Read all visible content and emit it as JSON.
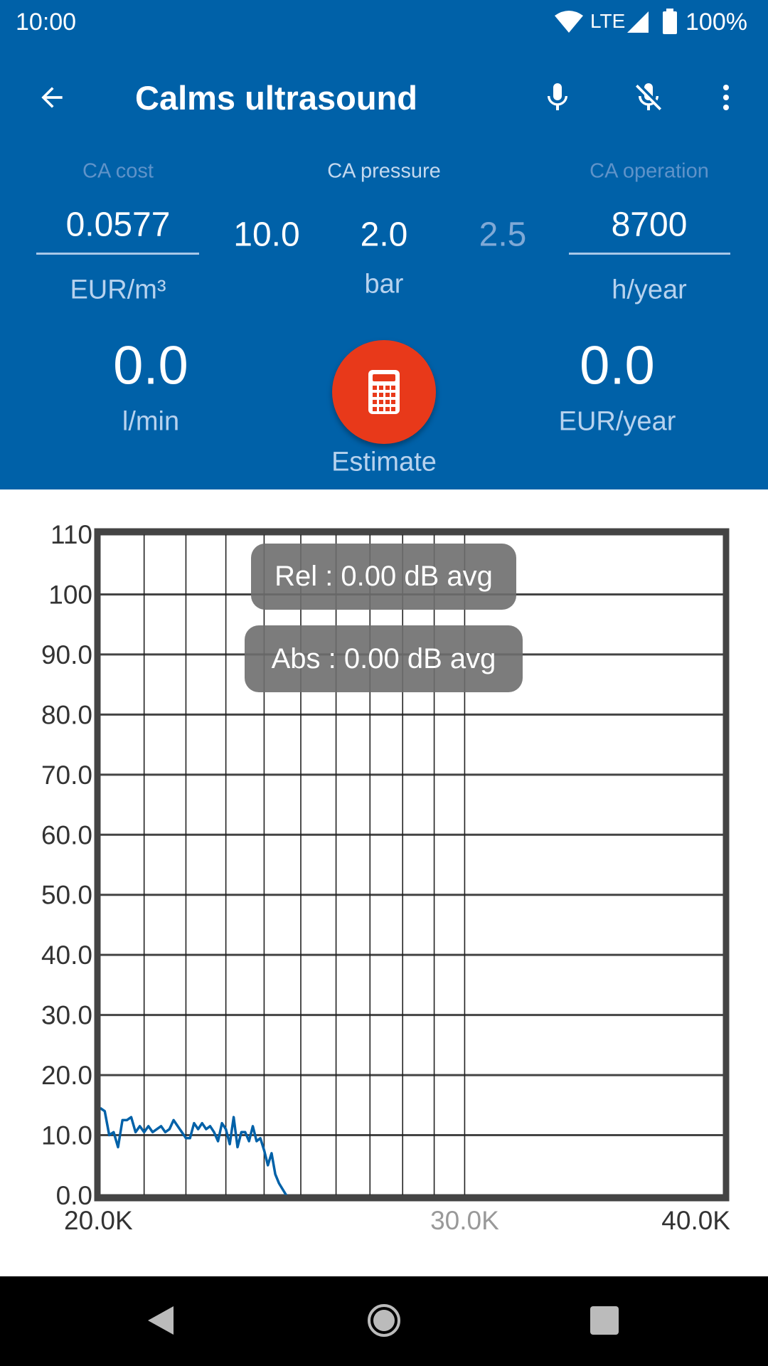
{
  "status_bar": {
    "time": "10:00",
    "network": "LTE",
    "battery": "100%",
    "icons": [
      "wifi-icon",
      "signal-icon",
      "battery-icon"
    ]
  },
  "toolbar": {
    "title": "Calms ultrasound",
    "icons": [
      "back-arrow-icon",
      "microphone-icon",
      "microphone-off-icon",
      "more-vert-icon"
    ]
  },
  "inputs": {
    "cost": {
      "label": "CA cost",
      "value": "0.0577",
      "unit": "EUR/m³"
    },
    "pressure": {
      "label": "CA pressure",
      "prev": "10.0",
      "value": "2.0",
      "next": "2.5",
      "unit": "bar"
    },
    "operation": {
      "label": "CA operation",
      "value": "8700",
      "unit": "h/year"
    }
  },
  "results": {
    "flow": {
      "value": "0.0",
      "unit": "l/min"
    },
    "cost": {
      "value": "0.0",
      "unit": "EUR/year"
    }
  },
  "estimate": {
    "label": "Estimate",
    "icon": "calculator-icon",
    "color": "#E8391A"
  },
  "colors": {
    "header": "#0061A8",
    "line": "#0061A8",
    "grid": "#444444"
  },
  "overlay": {
    "rel": "Rel : 0.00 dB avg",
    "abs": "Abs : 0.00 dB avg"
  },
  "chart_data": {
    "type": "line",
    "x_scale": "log",
    "xlim": [
      20000,
      40000
    ],
    "ylim": [
      0,
      110
    ],
    "grid": true,
    "x_ticks": [
      {
        "value": 20000,
        "label": "20.0K"
      },
      {
        "value": 30000,
        "label": "30.0K"
      },
      {
        "value": 40000,
        "label": "40.0K"
      }
    ],
    "x_gridlines": [
      21000,
      22000,
      23000,
      24000,
      25000,
      26000,
      27000,
      28000,
      29000,
      30000
    ],
    "y_ticks": [
      {
        "value": 0,
        "label": "0.0"
      },
      {
        "value": 10,
        "label": "10.0"
      },
      {
        "value": 20,
        "label": "20.0"
      },
      {
        "value": 30,
        "label": "30.0"
      },
      {
        "value": 40,
        "label": "40.0"
      },
      {
        "value": 50,
        "label": "50.0"
      },
      {
        "value": 60,
        "label": "60.0"
      },
      {
        "value": 70,
        "label": "70.0"
      },
      {
        "value": 80,
        "label": "80.0"
      },
      {
        "value": 90,
        "label": "90.0"
      },
      {
        "value": 100,
        "label": "100"
      },
      {
        "value": 110,
        "label": "110"
      }
    ],
    "series": [
      {
        "x": [
          20000,
          20100,
          20200,
          20300,
          20400,
          20500,
          20600,
          20700,
          20800,
          20900,
          21000,
          21100,
          21200,
          21300,
          21400,
          21500,
          21600,
          21700,
          21800,
          21900,
          22000,
          22100,
          22200,
          22300,
          22400,
          22500,
          22600,
          22700,
          22800,
          22900,
          23000,
          23100,
          23200,
          23300,
          23400,
          23500,
          23600,
          23700,
          23800,
          23900,
          24000,
          24100,
          24200,
          24300,
          24400,
          24600
        ],
        "y": [
          14.5,
          14,
          10,
          10.5,
          8,
          12.5,
          12.5,
          13,
          10.5,
          11.5,
          10.5,
          11.5,
          10.5,
          11,
          11.5,
          10.5,
          11,
          12.5,
          11.5,
          10.5,
          9.5,
          9.5,
          12,
          11,
          12,
          11,
          11.5,
          10.5,
          9,
          12,
          11,
          8.5,
          13,
          8,
          10.5,
          10.5,
          9,
          11.5,
          9,
          9.5,
          7.5,
          5,
          7,
          3.5,
          2,
          0
        ]
      }
    ]
  }
}
